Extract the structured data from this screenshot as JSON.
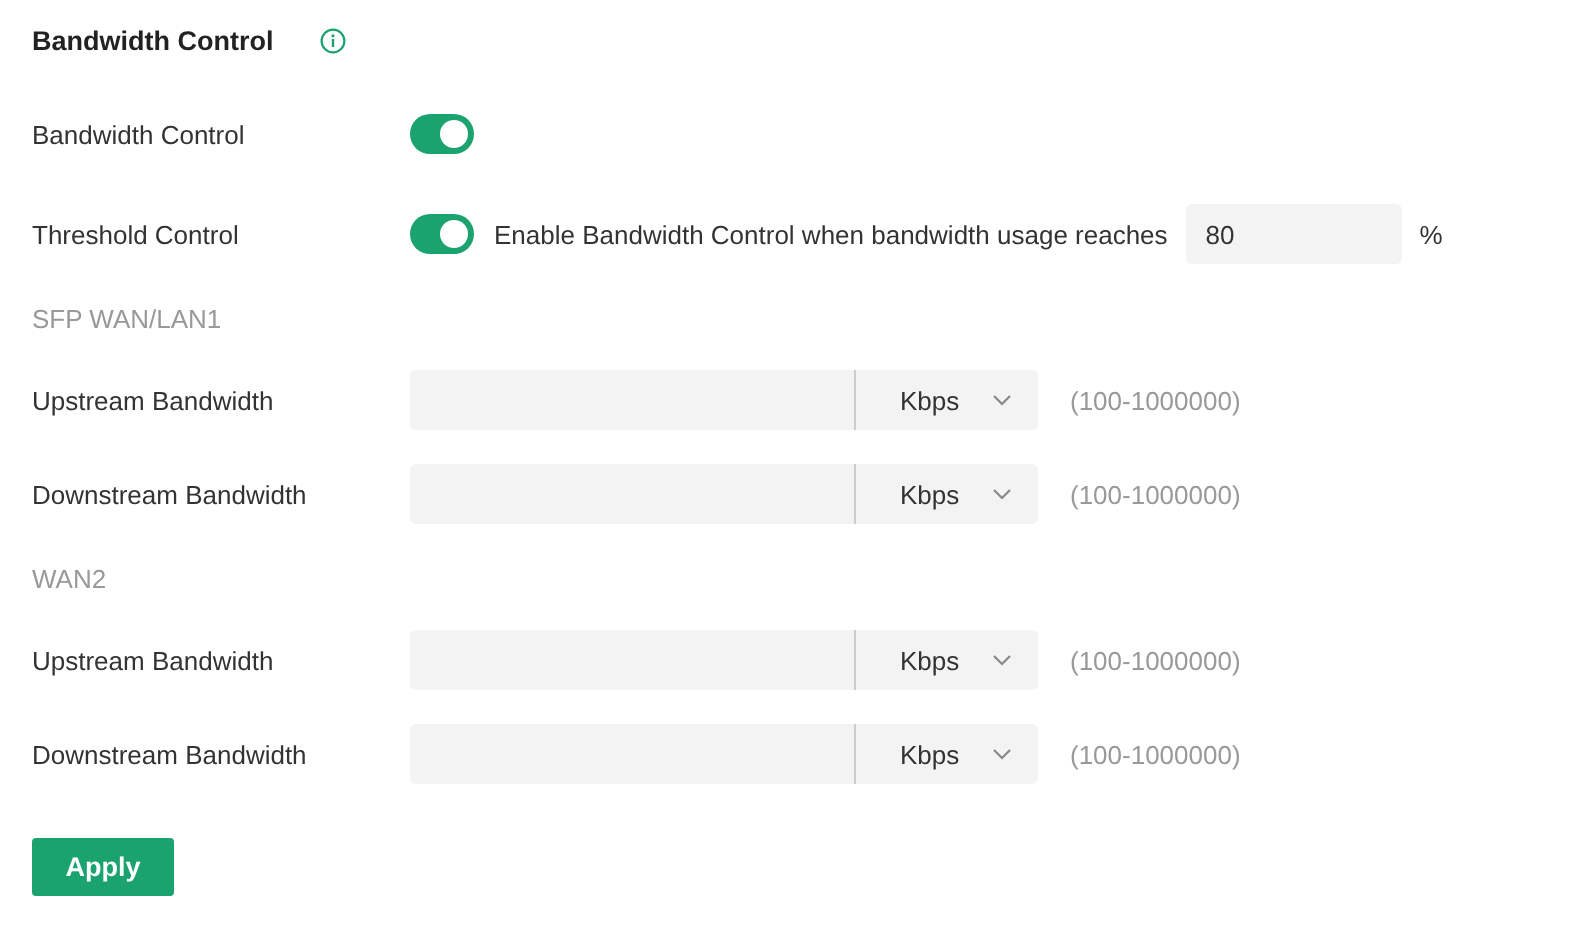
{
  "title": "Bandwidth Control",
  "bandwidth_control": {
    "label": "Bandwidth Control",
    "on": true
  },
  "threshold_control": {
    "label": "Threshold Control",
    "on": true,
    "text": "Enable Bandwidth Control when bandwidth usage reaches",
    "value": "80",
    "unit": "%"
  },
  "sections": [
    {
      "name": "SFP WAN/LAN1",
      "rows": [
        {
          "label": "Upstream Bandwidth",
          "unit": "Kbps",
          "hint": "(100-1000000)"
        },
        {
          "label": "Downstream Bandwidth",
          "unit": "Kbps",
          "hint": "(100-1000000)"
        }
      ]
    },
    {
      "name": "WAN2",
      "rows": [
        {
          "label": "Upstream Bandwidth",
          "unit": "Kbps",
          "hint": "(100-1000000)"
        },
        {
          "label": "Downstream Bandwidth",
          "unit": "Kbps",
          "hint": "(100-1000000)"
        }
      ]
    }
  ],
  "apply_button": "Apply"
}
